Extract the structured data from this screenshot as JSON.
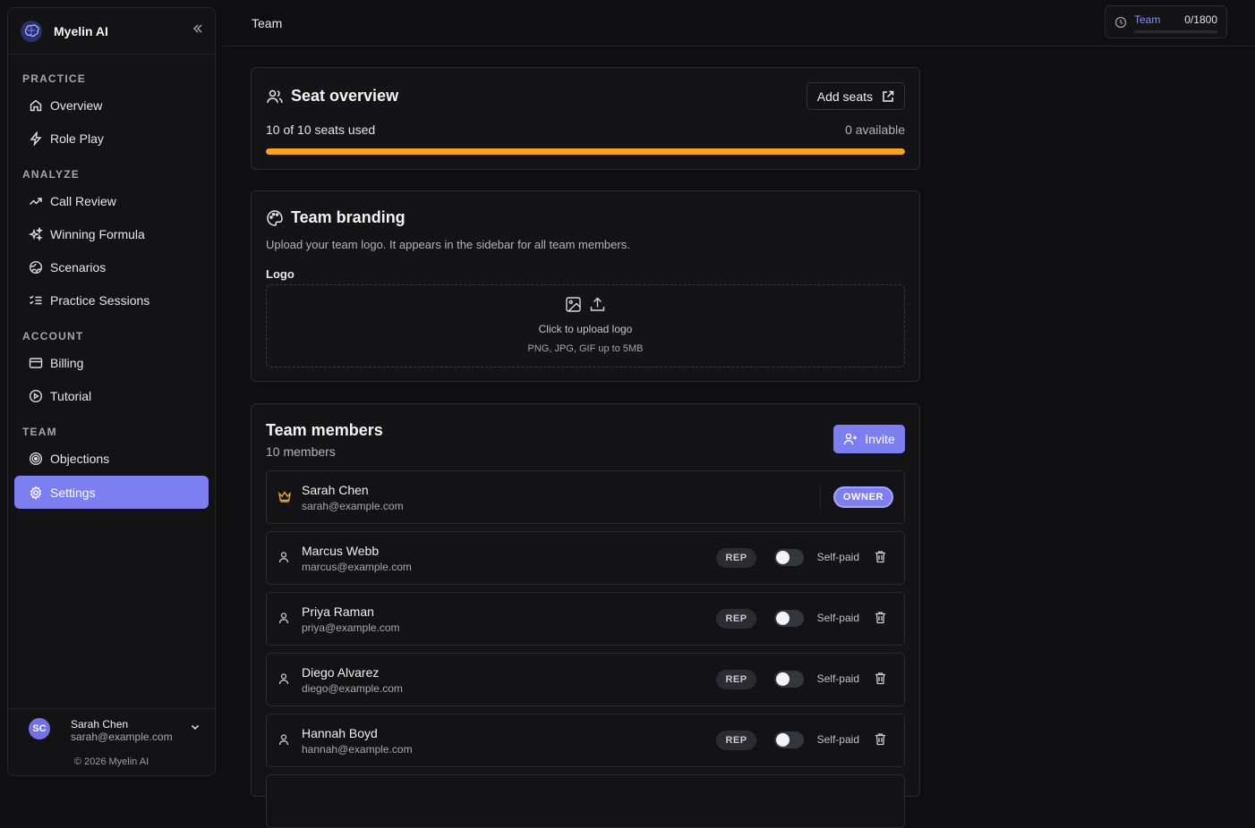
{
  "app": {
    "name": "Myelin AI"
  },
  "sidebar": {
    "sections": [
      {
        "label": "PRACTICE",
        "items": [
          {
            "label": "Overview",
            "icon": "home-icon"
          },
          {
            "label": "Role Play",
            "icon": "bolt-icon"
          }
        ]
      },
      {
        "label": "ANALYZE",
        "items": [
          {
            "label": "Call Review",
            "icon": "trending-icon"
          },
          {
            "label": "Winning Formula",
            "icon": "sparkles-icon"
          },
          {
            "label": "Scenarios",
            "icon": "globe-icon"
          },
          {
            "label": "Practice Sessions",
            "icon": "list-check-icon"
          }
        ]
      },
      {
        "label": "ACCOUNT",
        "items": [
          {
            "label": "Billing",
            "icon": "card-icon"
          },
          {
            "label": "Tutorial",
            "icon": "play-circle-icon"
          }
        ]
      },
      {
        "label": "TEAM",
        "items": [
          {
            "label": "Objections",
            "icon": "target-icon"
          },
          {
            "label": "Settings",
            "icon": "gear-icon",
            "active": true
          }
        ]
      }
    ],
    "user": {
      "initials": "SC",
      "name": "Sarah Chen",
      "email": "sarah@example.com"
    },
    "copyright": "© 2026 Myelin AI"
  },
  "header": {
    "title": "Team",
    "usage": {
      "label": "Team",
      "value": "0/1800",
      "fraction": 0
    }
  },
  "seat_overview": {
    "title": "Seat overview",
    "add_seats_label": "Add seats",
    "used_text": "10 of 10 seats used",
    "available_text": "0 available",
    "used": 10,
    "total": 10,
    "bar_color": "#f5a524"
  },
  "branding": {
    "title": "Team branding",
    "description": "Upload your team logo. It appears in the sidebar for all team members.",
    "logo_label": "Logo",
    "upload_text": "Click to upload logo",
    "upload_hint": "PNG, JPG, GIF up to 5MB"
  },
  "members": {
    "title": "Team members",
    "count_text": "10 members",
    "invite_label": "Invite",
    "owner": {
      "name": "Sarah Chen",
      "email": "sarah@example.com",
      "role": "OWNER"
    },
    "list": [
      {
        "name": "Marcus Webb",
        "email": "marcus@example.com",
        "role": "REP",
        "toggle_label": "Self-paid"
      },
      {
        "name": "Priya Raman",
        "email": "priya@example.com",
        "role": "REP",
        "toggle_label": "Self-paid"
      },
      {
        "name": "Diego Alvarez",
        "email": "diego@example.com",
        "role": "REP",
        "toggle_label": "Self-paid"
      },
      {
        "name": "Hannah Boyd",
        "email": "hannah@example.com",
        "role": "REP",
        "toggle_label": "Self-paid"
      }
    ]
  },
  "colors": {
    "accent": "#7d7ff0",
    "warning": "#f5a524",
    "background": "#0f0f11"
  }
}
